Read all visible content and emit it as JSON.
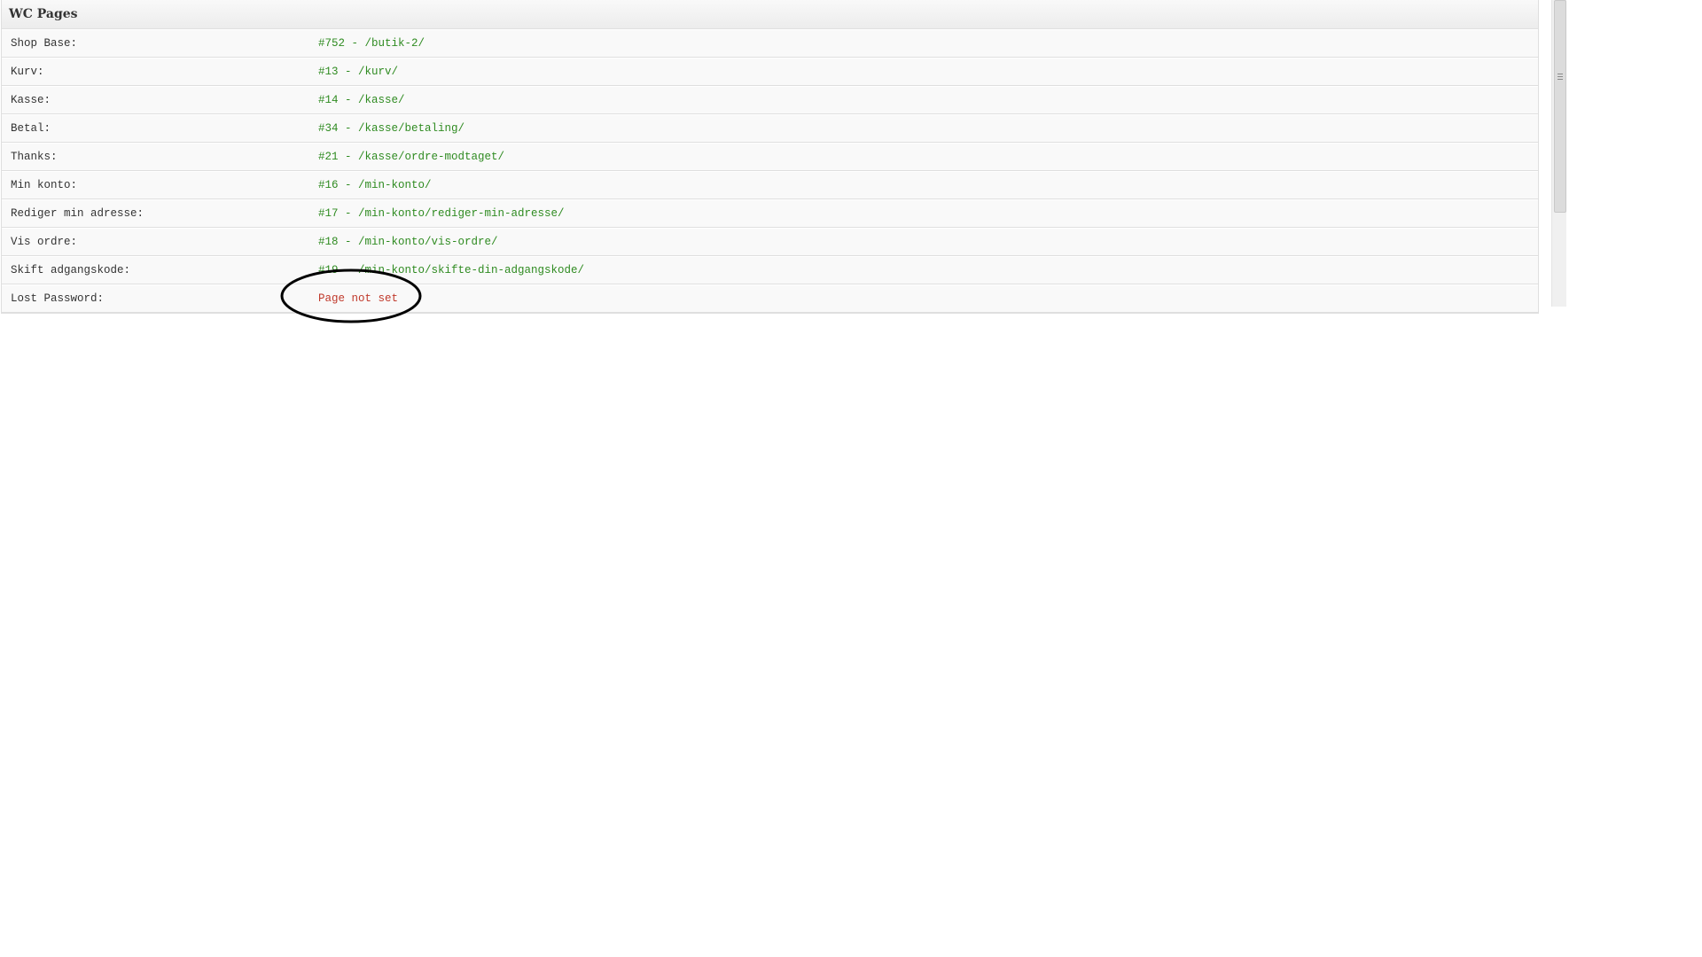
{
  "panel": {
    "title": "WC Pages"
  },
  "rows": [
    {
      "label": "Shop Base:",
      "value": "#752 - /butik-2/",
      "status": "ok"
    },
    {
      "label": "Kurv:",
      "value": "#13 - /kurv/",
      "status": "ok"
    },
    {
      "label": "Kasse:",
      "value": "#14 - /kasse/",
      "status": "ok"
    },
    {
      "label": "Betal:",
      "value": "#34 - /kasse/betaling/",
      "status": "ok"
    },
    {
      "label": "Thanks:",
      "value": "#21 - /kasse/ordre-modtaget/",
      "status": "ok"
    },
    {
      "label": "Min konto:",
      "value": "#16 - /min-konto/",
      "status": "ok"
    },
    {
      "label": "Rediger min adresse:",
      "value": "#17 - /min-konto/rediger-min-adresse/",
      "status": "ok"
    },
    {
      "label": "Vis ordre:",
      "value": "#18 - /min-konto/vis-ordre/",
      "status": "ok"
    },
    {
      "label": "Skift adgangskode:",
      "value": "#19 - /min-konto/skifte-din-adgangskode/",
      "status": "ok"
    },
    {
      "label": "Lost Password:",
      "value": "Page not set",
      "status": "error"
    }
  ],
  "colors": {
    "ok": "#2f8b21",
    "error": "#c0392b",
    "annotation": "#000000"
  },
  "icons": {
    "scroll_grip": "grip-lines-icon"
  }
}
